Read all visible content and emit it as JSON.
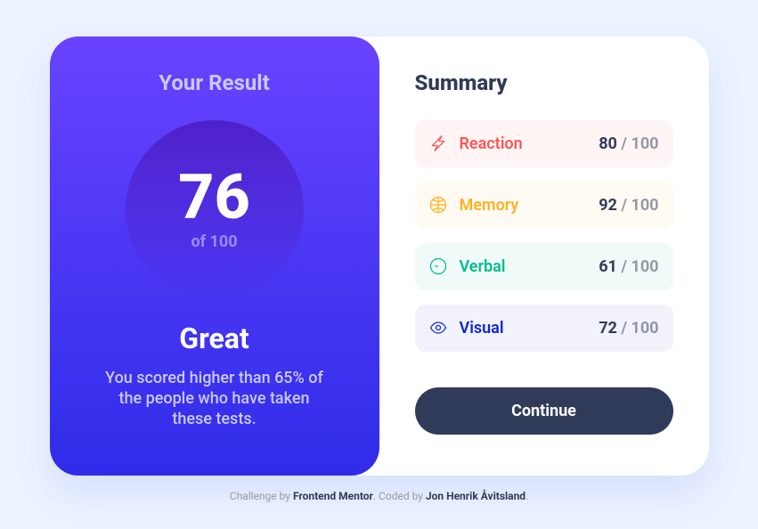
{
  "result": {
    "title": "Your Result",
    "score": "76",
    "of_label": "of 100",
    "rating": "Great",
    "description": "You scored higher than 65% of the people who have taken these tests."
  },
  "summary": {
    "title": "Summary",
    "items": [
      {
        "key": "reaction",
        "label": "Reaction",
        "score": "80",
        "max": "/ 100",
        "icon": "bolt-icon",
        "color": "#ff5555"
      },
      {
        "key": "memory",
        "label": "Memory",
        "score": "92",
        "max": "/ 100",
        "icon": "brain-icon",
        "color": "#ffb21e"
      },
      {
        "key": "verbal",
        "label": "Verbal",
        "score": "61",
        "max": "/ 100",
        "icon": "chat-icon",
        "color": "#00bb8f"
      },
      {
        "key": "visual",
        "label": "Visual",
        "score": "72",
        "max": "/ 100",
        "icon": "eye-icon",
        "color": "#1125d6"
      }
    ],
    "button": "Continue"
  },
  "attribution": {
    "prefix": "Challenge by ",
    "link1": "Frontend Mentor",
    "middle": ". Coded by ",
    "link2": "Jon Henrik Åvitsland",
    "suffix": "."
  }
}
